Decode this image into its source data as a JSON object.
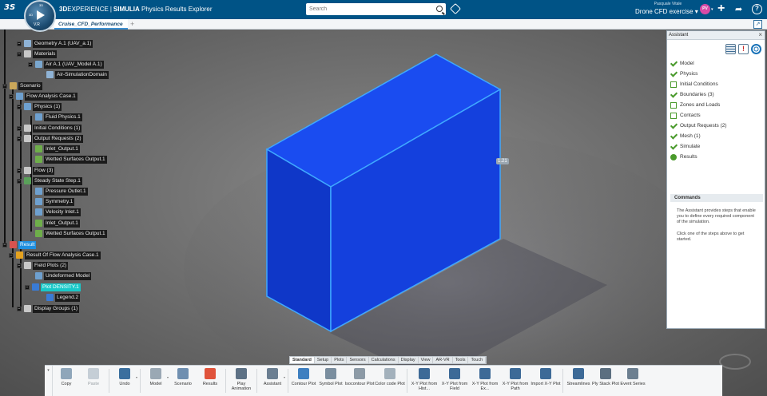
{
  "header": {
    "brand_bold": "3D",
    "brand_rest": "EXPERIENCE",
    "product_bold": "SIMULIA",
    "app_name": "Physics Results Explorer",
    "search_placeholder": "Search",
    "user_name": "Pasquale Vitale",
    "project": "Drone CFD exercise",
    "avatar_initials": "PV",
    "compass_version": "V.R",
    "compass_top": "3D",
    "compass_left": "3D",
    "compass_right": "",
    "brand_logo_text": "3S"
  },
  "tabs": {
    "active": "Cruise_CFD_Performance",
    "add": "+"
  },
  "viewport": {
    "dimension_label": "1.21",
    "model_color": "#1446e8",
    "model_edge_color": "#3fa8ff"
  },
  "tree": {
    "items": [
      {
        "label": "Geometry A.1 (UAV_a.1)",
        "icon_color": "#8fb3d6"
      },
      {
        "label": "Materials",
        "icon_color": "#c8c8c8"
      },
      {
        "label": "Air A.1 (UAV_Model A.1)",
        "icon_color": "#7aa7cf"
      },
      {
        "label": "Air-SimulationDomain",
        "icon_color": "#8fb3d6"
      },
      {
        "label": "Scenario",
        "icon_color": "#caa75a"
      },
      {
        "label": "Flow Analysis Case.1",
        "icon_color": "#6ea0cf"
      },
      {
        "label": "Physics (1)",
        "icon_color": "#6ea0cf"
      },
      {
        "label": "Fluid Physics.1",
        "icon_color": "#6ea0cf"
      },
      {
        "label": "Initial Conditions (1)",
        "icon_color": "#c8c8c8"
      },
      {
        "label": "Output Requests (2)",
        "icon_color": "#c8c8c8"
      },
      {
        "label": "Inlet_Output.1",
        "icon_color": "#6eae4a"
      },
      {
        "label": "Wetted Surfaces Output.1",
        "icon_color": "#6eae4a"
      },
      {
        "label": "Flow (3)",
        "icon_color": "#c8c8c8"
      },
      {
        "label": "Steady State Step.1",
        "icon_color": "#5aa05a"
      },
      {
        "label": "Pressure Outlet.1",
        "icon_color": "#6ea0cf"
      },
      {
        "label": "Symmetry.1",
        "icon_color": "#6ea0cf"
      },
      {
        "label": "Velocity Inlet.1",
        "icon_color": "#6ea0cf"
      },
      {
        "label": "Inlet_Output.1",
        "icon_color": "#6eae4a"
      },
      {
        "label": "Wetted Surfaces Output.1",
        "icon_color": "#6eae4a"
      },
      {
        "label": "Result",
        "icon_color": "#d9534f"
      },
      {
        "label": "Result Of Flow Analysis Case.1",
        "icon_color": "#e5a21f"
      },
      {
        "label": "Field Plots (2)",
        "icon_color": "#c8c8c8"
      },
      {
        "label": "Undeformed Model",
        "icon_color": "#6ea0cf"
      },
      {
        "label": "Plot DENSITY.1",
        "icon_color": "#3a7bd5"
      },
      {
        "label": "Legend.2",
        "icon_color": "#3a7bd5"
      },
      {
        "label": "Display Groups (1)",
        "icon_color": "#c8c8c8"
      }
    ]
  },
  "assistant": {
    "title": "Assistant",
    "close": "×",
    "steps": [
      {
        "label": "Model",
        "state": "done"
      },
      {
        "label": "Physics",
        "state": "done"
      },
      {
        "label": "Initial Conditions",
        "state": "todo"
      },
      {
        "label": "Boundaries (3)",
        "state": "done"
      },
      {
        "label": "Zones and Loads",
        "state": "todo"
      },
      {
        "label": "Contacts",
        "state": "todo"
      },
      {
        "label": "Output Requests (2)",
        "state": "done"
      },
      {
        "label": "Mesh (1)",
        "state": "done"
      },
      {
        "label": "Simulate",
        "state": "done"
      },
      {
        "label": "Results",
        "state": "current"
      }
    ],
    "commands_title": "Commands",
    "commands_text_1": "The Assistant provides steps that enable you to define every required component of the simulation.",
    "commands_text_2": "Click one of the steps above to get started."
  },
  "categories": [
    "Standard",
    "Setup",
    "Plots",
    "Sensors",
    "Calculations",
    "Display",
    "View",
    "AR-VR",
    "Tools",
    "Touch"
  ],
  "active_category": "Standard",
  "toolbar": {
    "groups": [
      [
        {
          "label": "Copy",
          "color": "#8fa6ba"
        },
        {
          "label": "Paste",
          "color": "#c5ced6",
          "disabled": true
        }
      ],
      [
        {
          "label": "Undo",
          "color": "#3b6f9e",
          "caret": true
        }
      ],
      [
        {
          "label": "Model",
          "color": "#9aa8b4",
          "caret": true
        },
        {
          "label": "Scenario",
          "color": "#6f8fb0"
        },
        {
          "label": "Results",
          "color": "#e0533b"
        }
      ],
      [
        {
          "label": "Play Animation",
          "color": "#5d7185"
        }
      ],
      [
        {
          "label": "Assistant",
          "color": "#6b7f92",
          "caret": true
        }
      ],
      [
        {
          "label": "Contour Plot",
          "color": "#3e7fc0"
        },
        {
          "label": "Symbol Plot",
          "color": "#7a8e9f"
        },
        {
          "label": "Isocontour Plot",
          "color": "#8c9aa6"
        },
        {
          "label": "Color code Plot",
          "color": "#a3b1bc"
        }
      ],
      [
        {
          "label": "X-Y Plot from Hist...",
          "color": "#3d6a97"
        },
        {
          "label": "X-Y Plot from Field",
          "color": "#3d6a97"
        },
        {
          "label": "X-Y Plot from Ex...",
          "color": "#3d6a97"
        },
        {
          "label": "X-Y Plot from Path",
          "color": "#3d6a97"
        },
        {
          "label": "Import X-Y Plot",
          "color": "#3d6a97"
        }
      ],
      [
        {
          "label": "Streamlines",
          "color": "#3d6a97"
        },
        {
          "label": "Ply Stack Plot",
          "color": "#5c6f80"
        },
        {
          "label": "Event Series",
          "color": "#6c7f90"
        }
      ]
    ]
  }
}
